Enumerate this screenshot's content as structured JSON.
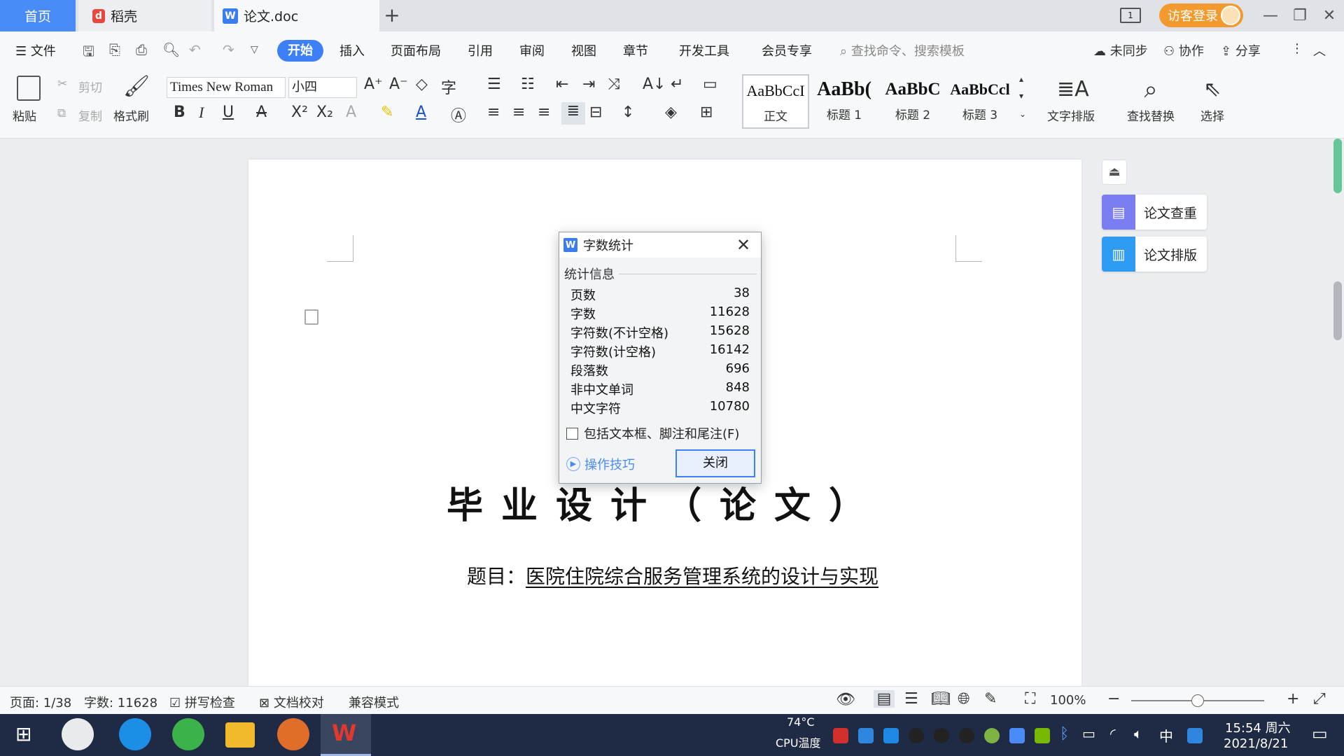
{
  "tabs": {
    "home": "首页",
    "daoke": "稻壳",
    "doc": "论文.doc",
    "new_tab": "+"
  },
  "titlebar": {
    "login": "访客登录",
    "panel_label": "1"
  },
  "menu": {
    "file": "文件",
    "items": [
      "开始",
      "插入",
      "页面布局",
      "引用",
      "审阅",
      "视图",
      "章节",
      "开发工具",
      "会员专享"
    ],
    "search_placeholder": "查找命令、搜索模板",
    "unsynced": "未同步",
    "collab": "协作",
    "share": "分享"
  },
  "ribbon": {
    "paste": "粘贴",
    "cut": "剪切",
    "copy": "复制",
    "format_painter": "格式刷",
    "font_name": "Times New Roman",
    "font_size": "小四",
    "styles": [
      {
        "sample": "AaBbCcI",
        "label": "正文"
      },
      {
        "sample": "AaBb(",
        "label": "标题 1"
      },
      {
        "sample": "AaBbC",
        "label": "标题 2"
      },
      {
        "sample": "AaBbCcl",
        "label": "标题 3"
      }
    ],
    "text_layout": "文字排版",
    "find_replace": "查找替换",
    "select": "选择"
  },
  "document": {
    "title": "毕业设计（论文）",
    "topic_prefix": "题目：",
    "topic": "医院住院综合服务管理系统的设计与实现"
  },
  "side_panel": {
    "check": "论文查重",
    "layout": "论文排版"
  },
  "dialog": {
    "title": "字数统计",
    "section": "统计信息",
    "stats": [
      {
        "label": "页数",
        "value": "38"
      },
      {
        "label": "字数",
        "value": "11628"
      },
      {
        "label": "字符数(不计空格)",
        "value": "15628"
      },
      {
        "label": "字符数(计空格)",
        "value": "16142"
      },
      {
        "label": "段落数",
        "value": "696"
      },
      {
        "label": "非中文单词",
        "value": "848"
      },
      {
        "label": "中文字符",
        "value": "10780"
      }
    ],
    "include_checkbox": "包括文本框、脚注和尾注(F)",
    "tips": "操作技巧",
    "close_button": "关闭"
  },
  "statusbar": {
    "page": "页面: 1/38",
    "word_count": "字数: 11628",
    "spell_check": "拼写检查",
    "doc_proof": "文档校对",
    "compat_mode": "兼容模式",
    "zoom": "100%",
    "zoom_level": 0.5
  },
  "taskbar": {
    "cpu_temp": "74°C",
    "cpu_label": "CPU温度",
    "ime": "中",
    "time": "15:54 周六",
    "date": "2021/8/21"
  },
  "colors": {
    "accent": "#3d7ff5",
    "tab_home": "#4a8cf7",
    "login": "#f29a2e",
    "taskbar": "#1f2a44"
  }
}
